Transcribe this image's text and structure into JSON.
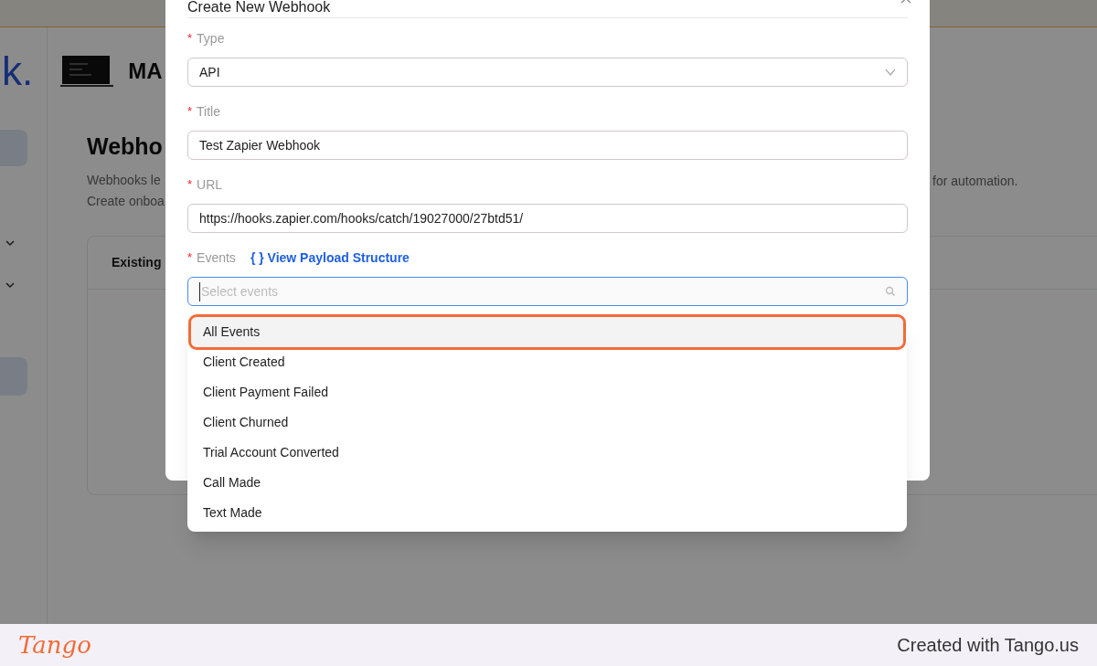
{
  "background_page": {
    "logo_text": "k.",
    "workspace_name": "MA",
    "heading": "Webho",
    "description_lines": [
      "Webhooks le",
      "Create onboa"
    ],
    "description_tail": "for automation.",
    "card_title": "Existing"
  },
  "dialog": {
    "title": "Create New Webhook",
    "fields": [
      {
        "kind": "select",
        "required_mark": "*",
        "label": "Type",
        "value": "API"
      },
      {
        "kind": "text",
        "required_mark": "*",
        "label": "Title",
        "value": "Test Zapier Webhook"
      },
      {
        "kind": "text",
        "required_mark": "*",
        "label": "URL",
        "value": "https://hooks.zapier.com/hooks/catch/19027000/27btd51/"
      },
      {
        "kind": "search",
        "required_mark": "*",
        "label": "Events",
        "placeholder": "Select events",
        "link_icon": "{ }",
        "link": "View Payload Structure"
      }
    ]
  },
  "dropdown": {
    "options": [
      {
        "label": "All Events",
        "selected": true
      },
      {
        "label": "Client Created",
        "selected": false
      },
      {
        "label": "Client Payment Failed",
        "selected": false
      },
      {
        "label": "Client Churned",
        "selected": false
      },
      {
        "label": "Trial Account Converted",
        "selected": false
      },
      {
        "label": "Call Made",
        "selected": false
      },
      {
        "label": "Text Made",
        "selected": false
      }
    ]
  },
  "footer": {
    "brand": "Tango",
    "credit": "Created with Tango.us"
  }
}
